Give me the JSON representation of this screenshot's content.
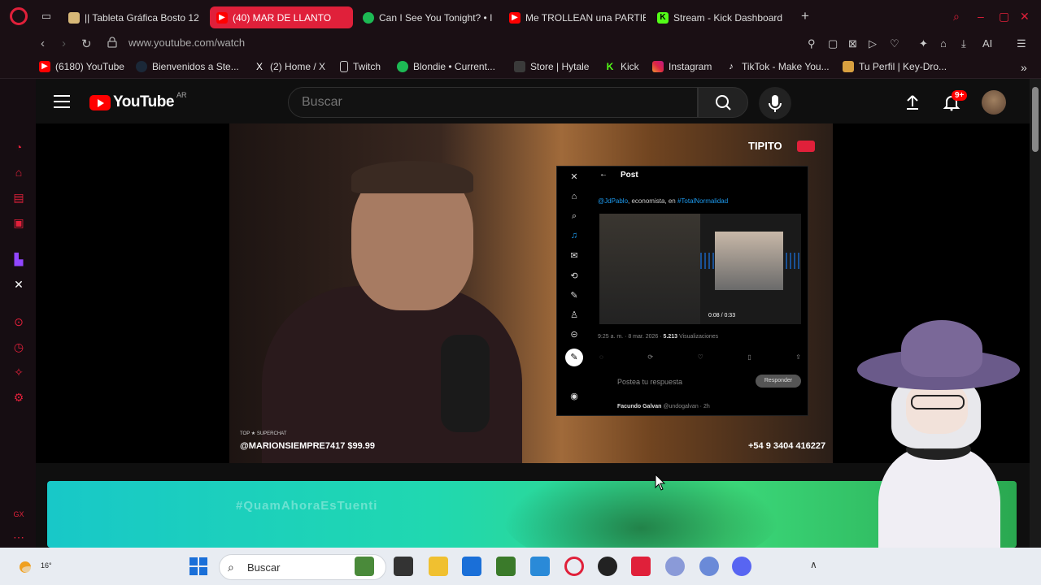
{
  "browser": {
    "tabs": [
      {
        "label": "|| Tableta Gráfica Bosto 12",
        "icon_color": "#d8b878"
      },
      {
        "label": "(40) MAR DE LLANTO",
        "icon_color": "#ff0000",
        "active": true
      },
      {
        "label": "Can I See You Tonight? • I",
        "icon_color": "#1db954"
      },
      {
        "label": "Me TROLLEAN una PARTIE",
        "icon_color": "#ff0000"
      },
      {
        "label": "Stream - Kick Dashboard",
        "icon_color": "#53fc18",
        "icon_letter": "K"
      }
    ],
    "url": "www.youtube.com/watch",
    "toolbar_ai_label": "AI",
    "bookmarks": [
      {
        "label": "(6180) YouTube",
        "icon_color": "#ff0000"
      },
      {
        "label": "Bienvenidos a Ste...",
        "icon_color": "#1b2838"
      },
      {
        "label": "(2) Home / X",
        "icon_color": "#000000",
        "icon_letter": "X"
      },
      {
        "label": "Twitch",
        "icon_color": "#9146ff"
      },
      {
        "label": "Blondie • Current...",
        "icon_color": "#1db954"
      },
      {
        "label": "Store | Hytale",
        "icon_color": "#3a3a3a"
      },
      {
        "label": "Kick",
        "icon_color": "#53fc18",
        "icon_letter": "K"
      },
      {
        "label": "Instagram",
        "icon_color": "#e1306c"
      },
      {
        "label": "TikTok - Make You...",
        "icon_color": "#000000"
      },
      {
        "label": "Tu Perfil | Key-Dro...",
        "icon_color": "#d8a040"
      }
    ]
  },
  "youtube": {
    "logo_text": "YouTube",
    "country": "AR",
    "search_placeholder": "Buscar",
    "notification_count": "9+"
  },
  "video": {
    "channel_tag": "TIPITO",
    "superchat_label": "TOP ★ SUPERCHAT",
    "superchat_text": "@MARIONSIEMPRE7417 $99.99",
    "phone_text": "+54 9 3404 416227",
    "xpost": {
      "title": "Post",
      "tweet_user": "@JdPablo",
      "tweet_text": ", economista, en ",
      "tweet_hashtag": "#TotalNormalidad",
      "media_time": "0:08 / 0:33",
      "meta_time": "9:25 a. m. · 8 mar. 2026 · ",
      "meta_views": "5.213",
      "meta_views_label": " Visualizaciones",
      "reply_placeholder": "Postea tu respuesta",
      "reply_button": "Responder",
      "author_name": "Facundo Galvan",
      "author_handle": " @undogalvan · 2h"
    }
  },
  "banner": {
    "text": "#QuamAhoraEsTuenti"
  },
  "taskbar": {
    "temperature": "16°",
    "search_label": "Buscar",
    "apps": [
      {
        "name": "nature-app",
        "color": "#4a8a3a"
      },
      {
        "name": "terminal-app",
        "color": "#333333"
      },
      {
        "name": "file-explorer-app",
        "color": "#f0c030"
      },
      {
        "name": "store-app",
        "color": "#1a6fd8"
      },
      {
        "name": "minecraft-app",
        "color": "#3a7a2a"
      },
      {
        "name": "photos-app",
        "color": "#2a8ad8"
      },
      {
        "name": "opera-app",
        "color": "#e0203a"
      },
      {
        "name": "obs-app",
        "color": "#222222"
      },
      {
        "name": "tiktok-app",
        "color": "#e0203a"
      },
      {
        "name": "vroid-app",
        "color": "#8a9ad8"
      },
      {
        "name": "settings-app",
        "color": "#6a8ad8"
      },
      {
        "name": "discord-app",
        "color": "#5865f2"
      }
    ]
  }
}
